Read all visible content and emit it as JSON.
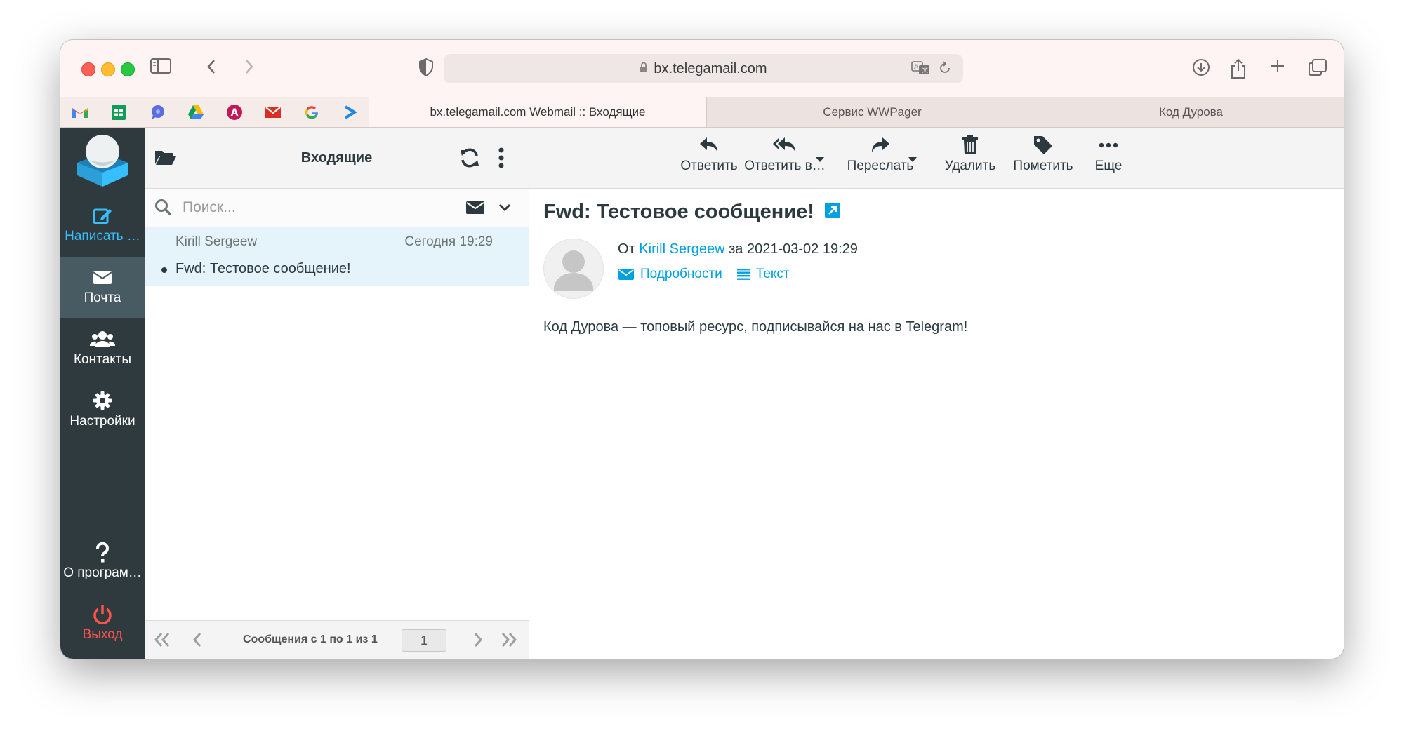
{
  "browser": {
    "url": "bx.telegamail.com",
    "tabs": [
      {
        "label": "bx.telegamail.com Webmail :: Входящие",
        "active": true
      },
      {
        "label": "Сервис WWPager",
        "active": false
      },
      {
        "label": "Код Дурова",
        "active": false
      }
    ],
    "favicons": [
      "gmail-icon",
      "sheets-icon",
      "messenger-icon",
      "drive-icon",
      "a-icon",
      "mail-icon",
      "google-icon",
      "arrow-app-icon"
    ]
  },
  "sidebar": {
    "compose": "Написать …",
    "mail": "Почта",
    "contacts": "Контакты",
    "settings": "Настройки",
    "about": "О програм…",
    "logout": "Выход"
  },
  "list": {
    "title": "Входящие",
    "search_placeholder": "Поиск...",
    "messages": [
      {
        "from": "Kirill Sergeew",
        "date": "Сегодня 19:29",
        "subject": "Fwd: Тестовое сообщение!"
      }
    ],
    "pager_info": "Сообщения с 1 по 1 из 1",
    "page": "1"
  },
  "toolbar": {
    "reply": "Ответить",
    "reply_all": "Ответить в…",
    "forward": "Переслать",
    "delete": "Удалить",
    "mark": "Пометить",
    "more": "Еще"
  },
  "message": {
    "subject": "Fwd: Тестовое сообщение!",
    "from_prefix": "От",
    "from_name": "Kirill Sergeew",
    "date_prefix": "за",
    "date": "2021-03-02 19:29",
    "details_link": "Подробности",
    "text_link": "Текст",
    "body": "Код Дурова — топовый ресурс, подписывайся на нас в Telegram!"
  },
  "colors": {
    "sidebar_bg": "#2f3a3f",
    "sidebar_active": "#485b63",
    "accent": "#00a1e0",
    "compose": "#37beff",
    "logout": "#ff5349",
    "selected_row": "#e5f3fb"
  }
}
